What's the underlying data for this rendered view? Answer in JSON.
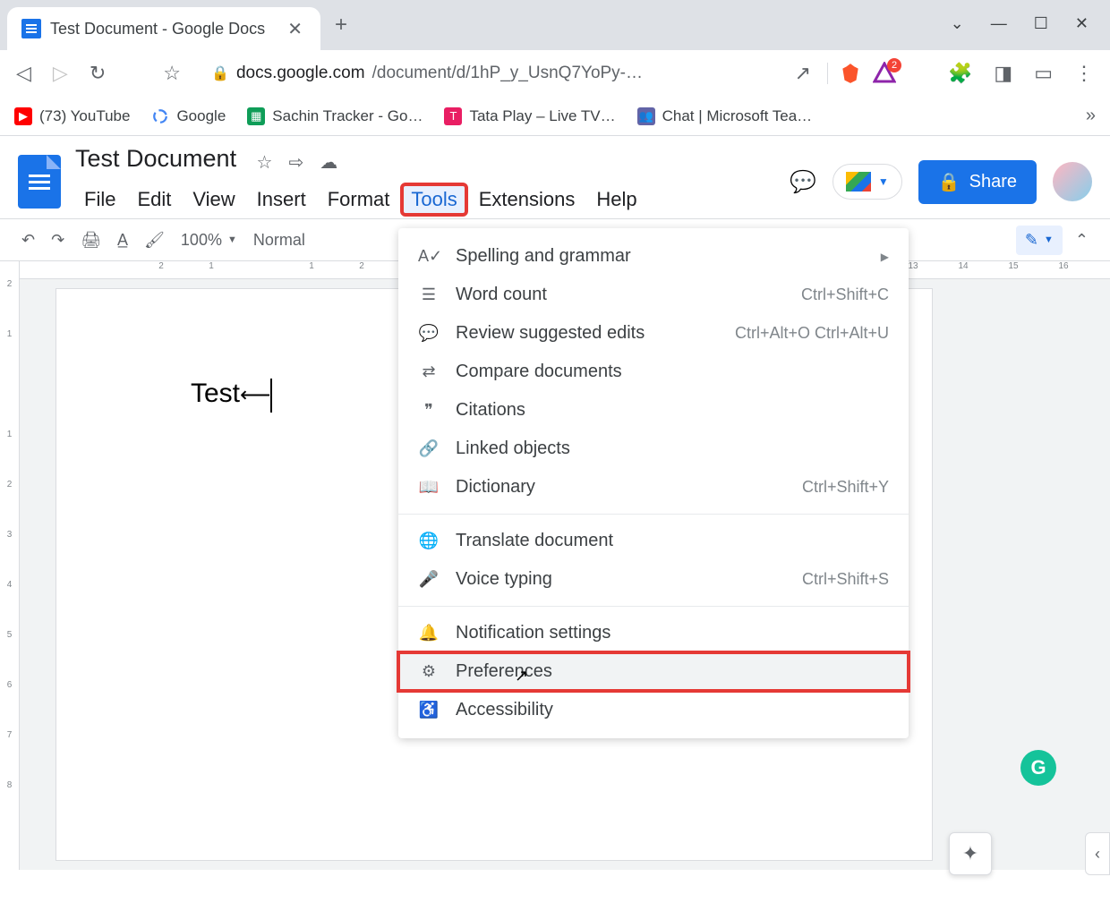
{
  "browser": {
    "tab_title": "Test Document - Google Docs",
    "url_domain": "docs.google.com",
    "url_path": "/document/d/1hP_y_UsnQ7YoPy-…",
    "bookmarks": [
      {
        "label": "(73) YouTube",
        "icon": "yt"
      },
      {
        "label": "Google",
        "icon": "goog"
      },
      {
        "label": "Sachin Tracker - Go…",
        "icon": "sheets"
      },
      {
        "label": "Tata Play – Live TV…",
        "icon": "tata"
      },
      {
        "label": "Chat | Microsoft Tea…",
        "icon": "teams"
      }
    ],
    "ext_badge": "2"
  },
  "docs": {
    "title": "Test Document",
    "share_label": "Share",
    "menus": [
      "File",
      "Edit",
      "View",
      "Insert",
      "Format",
      "Tools",
      "Extensions",
      "Help"
    ],
    "active_menu_index": 5,
    "zoom": "100%",
    "style": "Normal"
  },
  "toolbar": {
    "zoom": "100%",
    "style": "Normal"
  },
  "ruler_h": [
    "2",
    "1",
    "",
    "1",
    "2",
    "",
    "",
    "",
    "",
    "",
    "",
    "",
    "",
    "",
    "",
    "13",
    "14",
    "15",
    "16"
  ],
  "ruler_v": [
    "2",
    "1",
    "",
    "1",
    "2",
    "3",
    "4",
    "5",
    "6",
    "7",
    "8"
  ],
  "page": {
    "content": "Test"
  },
  "dropdown": {
    "items": [
      {
        "label": "Spelling and grammar",
        "icon": "A✓",
        "arrow": true
      },
      {
        "label": "Word count",
        "icon": "☰",
        "shortcut": "Ctrl+Shift+C"
      },
      {
        "label": "Review suggested edits",
        "icon": "💬",
        "shortcut": "Ctrl+Alt+O Ctrl+Alt+U"
      },
      {
        "label": "Compare documents",
        "icon": "⇄"
      },
      {
        "label": "Citations",
        "icon": "❞"
      },
      {
        "label": "Linked objects",
        "icon": "🔗"
      },
      {
        "label": "Dictionary",
        "icon": "📖",
        "shortcut": "Ctrl+Shift+Y"
      },
      {
        "sep": true
      },
      {
        "label": "Translate document",
        "icon": "🌐"
      },
      {
        "label": "Voice typing",
        "icon": "🎤",
        "shortcut": "Ctrl+Shift+S"
      },
      {
        "sep": true
      },
      {
        "label": "Notification settings",
        "icon": "🔔"
      },
      {
        "label": "Preferences",
        "icon": "⚙",
        "hover": true,
        "highlight": true
      },
      {
        "label": "Accessibility",
        "icon": "♿"
      }
    ]
  }
}
